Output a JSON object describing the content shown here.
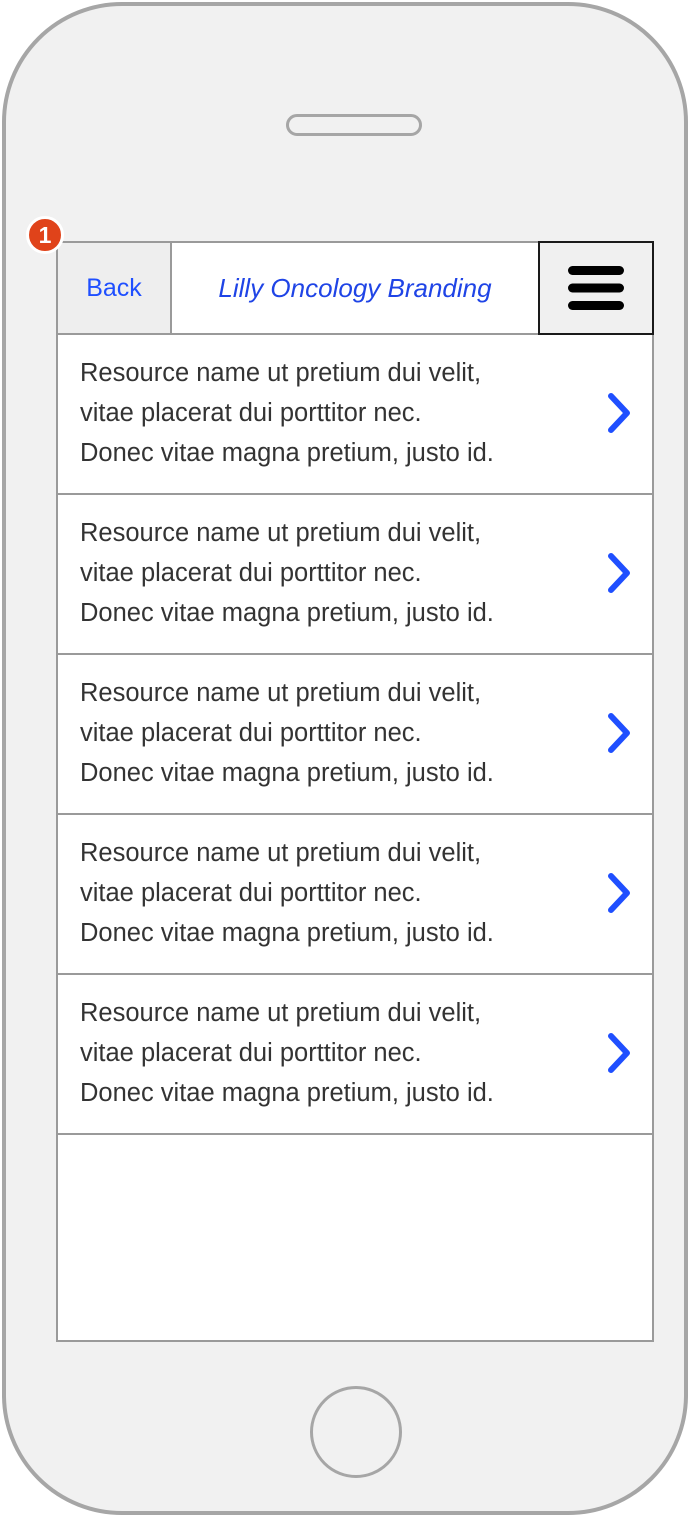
{
  "header": {
    "back_label": "Back",
    "title": "Lilly Oncology Branding",
    "menu_icon": "hamburger-menu-icon"
  },
  "annotation": {
    "badge_number": "1",
    "color": "#e0431a"
  },
  "list": {
    "items": [
      {
        "lines": [
          "Resource name ut pretium dui velit,",
          "vitae placerat dui porttitor nec.",
          "Donec vitae magna pretium, justo id."
        ]
      },
      {
        "lines": [
          "Resource name ut pretium dui velit,",
          "vitae placerat dui porttitor nec.",
          "Donec vitae magna pretium, justo id."
        ]
      },
      {
        "lines": [
          "Resource name ut pretium dui velit,",
          "vitae placerat dui porttitor nec.",
          "Donec vitae magna pretium, justo id."
        ]
      },
      {
        "lines": [
          "Resource name ut pretium dui velit,",
          "vitae placerat dui porttitor nec.",
          "Donec vitae magna pretium, justo id."
        ]
      },
      {
        "lines": [
          "Resource name ut pretium dui velit,",
          "vitae placerat dui porttitor nec.",
          "Donec vitae magna pretium, justo id."
        ]
      }
    ],
    "chevron_icon": "chevron-right-icon"
  },
  "colors": {
    "accent": "#1f4fff",
    "phone_frame": "#a6a6a6",
    "phone_body": "#f1f1f1",
    "text": "#333333",
    "divider": "#9a9a9a"
  }
}
